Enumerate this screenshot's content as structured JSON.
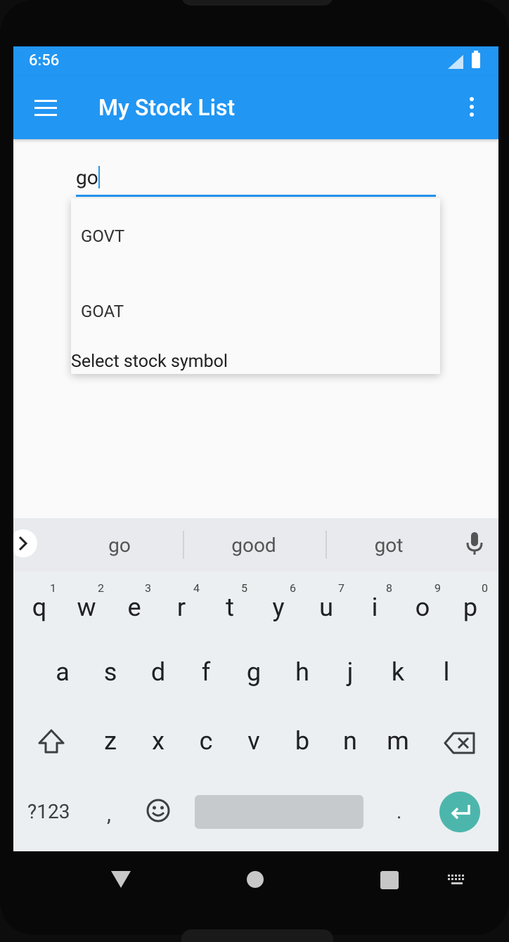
{
  "status": {
    "time": "6:56"
  },
  "appbar": {
    "title": "My Stock List"
  },
  "search": {
    "value": "go"
  },
  "dropdown": {
    "items": [
      {
        "label": "GOVT"
      },
      {
        "label": "GOAT"
      }
    ],
    "hint": "Select stock symbol"
  },
  "keyboard": {
    "suggestions": [
      "go",
      "good",
      "got"
    ],
    "row1": [
      {
        "key": "q",
        "num": "1"
      },
      {
        "key": "w",
        "num": "2"
      },
      {
        "key": "e",
        "num": "3"
      },
      {
        "key": "r",
        "num": "4"
      },
      {
        "key": "t",
        "num": "5"
      },
      {
        "key": "y",
        "num": "6"
      },
      {
        "key": "u",
        "num": "7"
      },
      {
        "key": "i",
        "num": "8"
      },
      {
        "key": "o",
        "num": "9"
      },
      {
        "key": "p",
        "num": "0"
      }
    ],
    "row2": [
      "a",
      "s",
      "d",
      "f",
      "g",
      "h",
      "j",
      "k",
      "l"
    ],
    "row3": [
      "z",
      "x",
      "c",
      "v",
      "b",
      "n",
      "m"
    ],
    "symbols_label": "?123",
    "comma": ",",
    "period": "."
  },
  "colors": {
    "primary": "#2196f3",
    "enter": "#4db6ac",
    "keyboard_bg": "#eceff1"
  }
}
